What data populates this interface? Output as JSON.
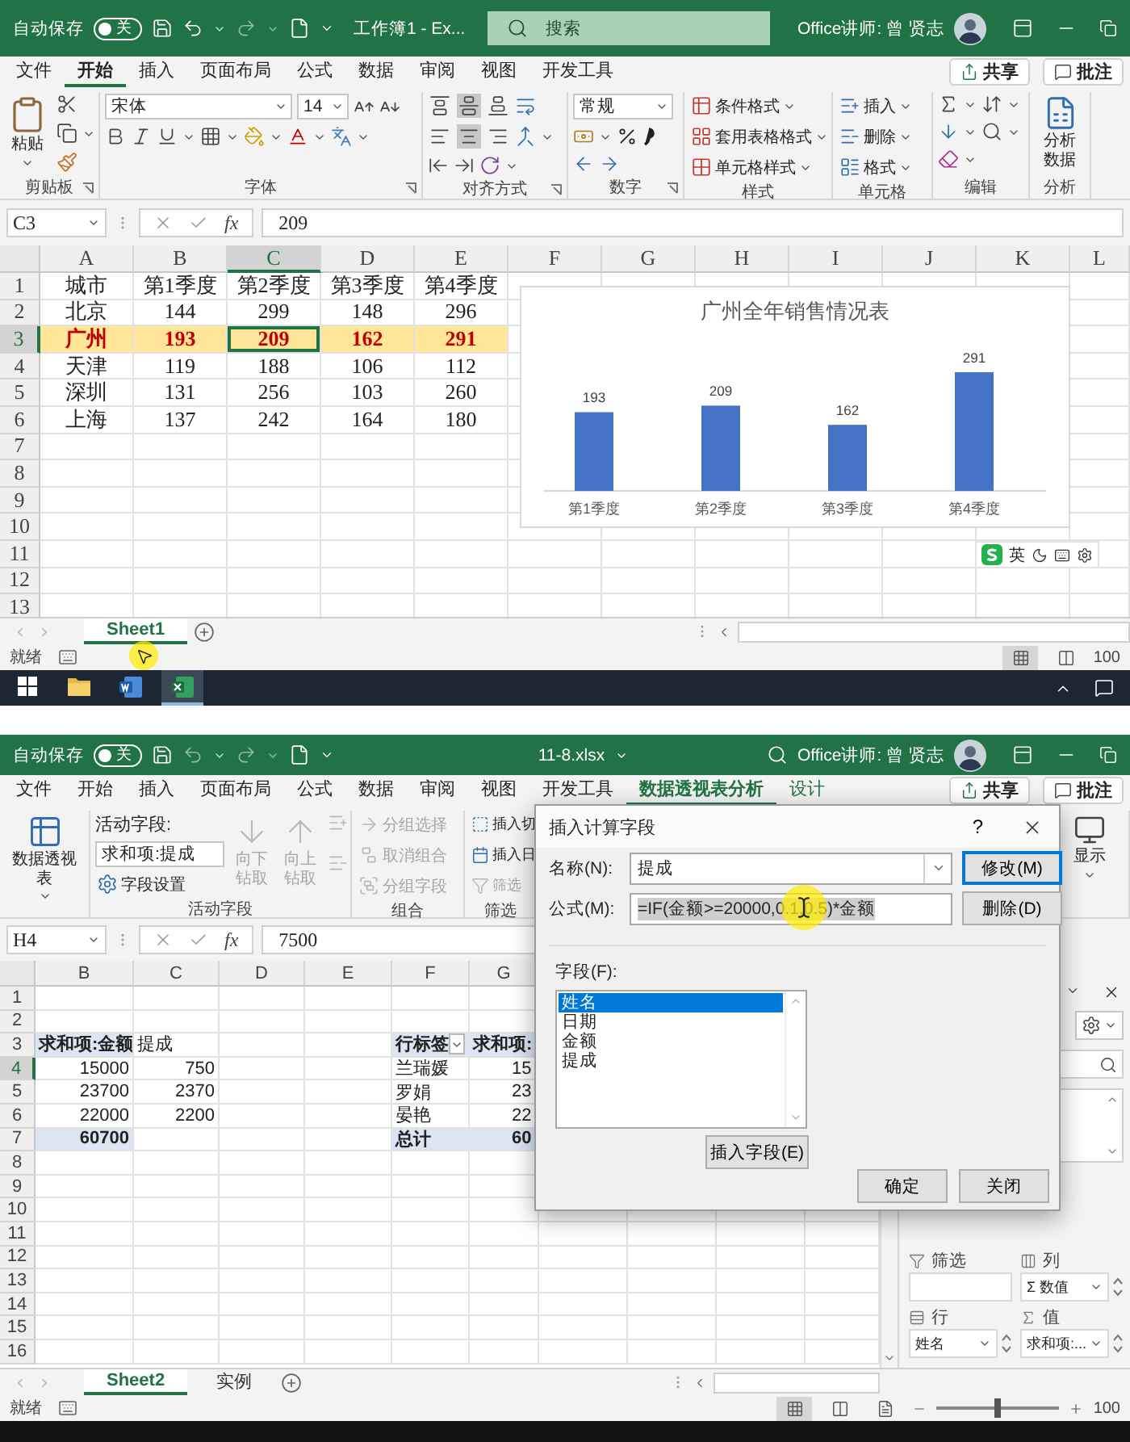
{
  "top_window": {
    "title_bar": {
      "autosave": "自动保存",
      "toggle": {
        "label": "关",
        "on": false
      },
      "document": "工作簿1 - Ex...",
      "search_placeholder": "搜索",
      "user": "Office讲师: 曾 贤志"
    },
    "tabs": [
      {
        "label": "文件",
        "selected": false
      },
      {
        "label": "开始",
        "selected": true
      },
      {
        "label": "插入",
        "selected": false
      },
      {
        "label": "页面布局",
        "selected": false
      },
      {
        "label": "公式",
        "selected": false
      },
      {
        "label": "数据",
        "selected": false
      },
      {
        "label": "审阅",
        "selected": false
      },
      {
        "label": "视图",
        "selected": false
      },
      {
        "label": "开发工具",
        "selected": false
      }
    ],
    "share_button": "共享",
    "comments_button": "批注",
    "ribbon": {
      "clipboard": {
        "paste": "粘贴",
        "label": "剪贴板"
      },
      "font": {
        "name": "宋体",
        "size": "14",
        "label": "字体"
      },
      "alignment": {
        "buttons": [
          {
            "selected": false
          },
          {
            "selected": true
          },
          {
            "selected": false
          },
          {
            "selected": false
          },
          {
            "selected": true
          },
          {
            "selected": false
          }
        ],
        "label": "对齐方式"
      },
      "number": {
        "format": "常规",
        "label": "数字"
      },
      "styles": {
        "items": [
          "条件格式",
          "套用表格格式",
          "单元格样式"
        ],
        "label": "样式"
      },
      "cells": {
        "items": [
          "插入",
          "删除",
          "格式"
        ],
        "label": "单元格"
      },
      "editing": {
        "label": "编辑"
      },
      "analysis": {
        "button": "分析数据",
        "label": "分析"
      }
    },
    "formula_bar": {
      "name_box": "C3",
      "fx": "fx",
      "value": "209"
    },
    "sheet": {
      "columns": [
        {
          "label": "A",
          "selected": false
        },
        {
          "label": "B",
          "selected": false
        },
        {
          "label": "C",
          "selected": true
        },
        {
          "label": "D",
          "selected": false
        },
        {
          "label": "E",
          "selected": false
        },
        {
          "label": "F",
          "selected": false
        },
        {
          "label": "G",
          "selected": false
        },
        {
          "label": "H",
          "selected": false
        },
        {
          "label": "I",
          "selected": false
        },
        {
          "label": "J",
          "selected": false
        },
        {
          "label": "K",
          "selected": false
        },
        {
          "label": "L",
          "selected": false
        }
      ],
      "rows": [
        {
          "header": "1",
          "selected": false,
          "highlighted": false,
          "cells": [
            {
              "text": "城市",
              "selected": false
            },
            {
              "text": "第1季度",
              "selected": false
            },
            {
              "text": "第2季度",
              "selected": false
            },
            {
              "text": "第3季度",
              "selected": false
            },
            {
              "text": "第4季度",
              "selected": false
            }
          ]
        },
        {
          "header": "2",
          "selected": false,
          "highlighted": false,
          "cells": [
            {
              "text": "北京",
              "selected": false
            },
            {
              "text": "144",
              "selected": false
            },
            {
              "text": "299",
              "selected": false
            },
            {
              "text": "148",
              "selected": false
            },
            {
              "text": "296",
              "selected": false
            }
          ]
        },
        {
          "header": "3",
          "selected": true,
          "highlighted": true,
          "cells": [
            {
              "text": "广州",
              "selected": false
            },
            {
              "text": "193",
              "selected": false
            },
            {
              "text": "209",
              "selected": true
            },
            {
              "text": "162",
              "selected": false
            },
            {
              "text": "291",
              "selected": false
            }
          ]
        },
        {
          "header": "4",
          "selected": false,
          "highlighted": false,
          "cells": [
            {
              "text": "天津",
              "selected": false
            },
            {
              "text": "119",
              "selected": false
            },
            {
              "text": "188",
              "selected": false
            },
            {
              "text": "106",
              "selected": false
            },
            {
              "text": "112",
              "selected": false
            }
          ]
        },
        {
          "header": "5",
          "selected": false,
          "highlighted": false,
          "cells": [
            {
              "text": "深圳",
              "selected": false
            },
            {
              "text": "131",
              "selected": false
            },
            {
              "text": "256",
              "selected": false
            },
            {
              "text": "103",
              "selected": false
            },
            {
              "text": "260",
              "selected": false
            }
          ]
        },
        {
          "header": "6",
          "selected": false,
          "highlighted": false,
          "cells": [
            {
              "text": "上海",
              "selected": false
            },
            {
              "text": "137",
              "selected": false
            },
            {
              "text": "242",
              "selected": false
            },
            {
              "text": "164",
              "selected": false
            },
            {
              "text": "180",
              "selected": false
            }
          ]
        },
        {
          "header": "7",
          "selected": false
        },
        {
          "header": "8",
          "selected": false
        },
        {
          "header": "9",
          "selected": false
        },
        {
          "header": "10",
          "selected": false
        },
        {
          "header": "11",
          "selected": false
        },
        {
          "header": "12",
          "selected": false
        },
        {
          "header": "13",
          "selected": false
        }
      ]
    },
    "chart_data": {
      "type": "bar",
      "title": "广州全年销售情况表",
      "categories": [
        "第1季度",
        "第2季度",
        "第3季度",
        "第4季度"
      ],
      "series": [
        {
          "color": "#4472c4",
          "values": [
            193,
            209,
            162,
            291
          ]
        }
      ],
      "data_labels": true
    },
    "ime": "英",
    "sheet_tabs": [
      {
        "label": "Sheet1",
        "selected": true
      }
    ],
    "status_bar": {
      "status": "就绪",
      "views": [
        {
          "selected": true
        },
        {
          "selected": false
        }
      ],
      "zoom": "100"
    },
    "taskbar": [
      {
        "kind": "start",
        "selected": false
      },
      {
        "kind": "folder",
        "selected": false
      },
      {
        "kind": "word",
        "selected": false
      },
      {
        "kind": "excel",
        "selected": true
      }
    ]
  },
  "bottom_window": {
    "title_bar": {
      "autosave": "自动保存",
      "toggle": {
        "label": "关",
        "on": false
      },
      "document": "11-8.xlsx",
      "user": "Office讲师: 曾 贤志"
    },
    "tabs": [
      {
        "label": "文件",
        "selected": false,
        "contextual": false
      },
      {
        "label": "开始",
        "selected": false,
        "contextual": false
      },
      {
        "label": "插入",
        "selected": false,
        "contextual": false
      },
      {
        "label": "页面布局",
        "selected": false,
        "contextual": false
      },
      {
        "label": "公式",
        "selected": false,
        "contextual": false
      },
      {
        "label": "数据",
        "selected": false,
        "contextual": false
      },
      {
        "label": "审阅",
        "selected": false,
        "contextual": false
      },
      {
        "label": "视图",
        "selected": false,
        "contextual": false
      },
      {
        "label": "开发工具",
        "selected": false,
        "contextual": false
      },
      {
        "label": "数据透视表分析",
        "selected": true,
        "contextual": true
      },
      {
        "label": "设计",
        "selected": false,
        "contextual": true
      }
    ],
    "share_button": "共享",
    "comments_button": "批注",
    "ribbon": {
      "pivot_table": "数据透视表",
      "active_field": {
        "caption": "活动字段:",
        "value": "求和项:提成",
        "settings": "字段设置",
        "drill_down": {
          "label": "向下钻取",
          "disabled": true
        },
        "drill_up": {
          "label": "向上钻取",
          "disabled": true
        },
        "label": "活动字段"
      },
      "group": {
        "items": [
          {
            "label": "分组选择",
            "disabled": true
          },
          {
            "label": "取消组合",
            "disabled": true
          },
          {
            "label": "分组字段",
            "disabled": true
          }
        ],
        "label": "组合"
      },
      "filter": {
        "items": [
          {
            "label": "插入切",
            "disabled": false
          },
          {
            "label": "插入日",
            "disabled": false
          },
          {
            "label": "筛选",
            "disabled": true
          }
        ],
        "label": "筛选"
      },
      "show": "显示"
    },
    "formula_bar": {
      "name_box": "H4",
      "fx": "fx",
      "value": "7500"
    },
    "sheet": {
      "columns": [
        {
          "label": "B",
          "selected": false
        },
        {
          "label": "C",
          "selected": false
        },
        {
          "label": "D",
          "selected": false
        },
        {
          "label": "E",
          "selected": false
        },
        {
          "label": "F",
          "selected": false
        },
        {
          "label": "G",
          "selected": false
        }
      ],
      "rows": [
        {
          "header": "1",
          "selected": false
        },
        {
          "header": "2",
          "selected": false
        },
        {
          "header": "3",
          "selected": false,
          "cells": [
            {
              "text": "求和项:金额",
              "kind": "header"
            },
            {
              "text": "提成",
              "kind": "label"
            },
            {
              "kind": "blank"
            },
            {
              "kind": "blank"
            },
            {
              "text": "行标签",
              "kind": "filter_header"
            },
            {
              "text": "求和项:",
              "kind": "header"
            }
          ]
        },
        {
          "header": "4",
          "selected": true,
          "cells": [
            {
              "text": "15000",
              "kind": "number"
            },
            {
              "text": "750",
              "kind": "number"
            },
            {
              "kind": "blank"
            },
            {
              "kind": "blank"
            },
            {
              "text": "兰瑞媛",
              "kind": "label"
            },
            {
              "text": "15",
              "kind": "partial"
            }
          ]
        },
        {
          "header": "5",
          "selected": false,
          "cells": [
            {
              "text": "23700",
              "kind": "number"
            },
            {
              "text": "2370",
              "kind": "number"
            },
            {
              "kind": "blank"
            },
            {
              "kind": "blank"
            },
            {
              "text": "罗娟",
              "kind": "label"
            },
            {
              "text": "23",
              "kind": "partial"
            }
          ]
        },
        {
          "header": "6",
          "selected": false,
          "cells": [
            {
              "text": "22000",
              "kind": "number"
            },
            {
              "text": "2200",
              "kind": "number"
            },
            {
              "kind": "blank"
            },
            {
              "kind": "blank"
            },
            {
              "text": "晏艳",
              "kind": "label"
            },
            {
              "text": "22",
              "kind": "partial"
            }
          ]
        },
        {
          "header": "7",
          "selected": false,
          "cells": [
            {
              "text": "60700",
              "kind": "total_number"
            },
            {
              "kind": "blank"
            },
            {
              "kind": "blank"
            },
            {
              "kind": "blank"
            },
            {
              "text": "总计",
              "kind": "total"
            },
            {
              "text": "60",
              "kind": "partial_total"
            }
          ]
        },
        {
          "header": "8",
          "selected": false
        },
        {
          "header": "9",
          "selected": false
        },
        {
          "header": "10",
          "selected": false
        },
        {
          "header": "11",
          "selected": false
        },
        {
          "header": "12",
          "selected": false
        },
        {
          "header": "13",
          "selected": false
        },
        {
          "header": "14",
          "selected": false
        },
        {
          "header": "15",
          "selected": false
        },
        {
          "header": "16",
          "selected": false
        }
      ]
    },
    "dialog": {
      "title": "插入计算字段",
      "help": "?",
      "name_label": "名称(N):",
      "name_value": "提成",
      "formula_label": "公式(M):",
      "formula_value": "=IF(金额>=20000,0.1,0.5)*金额",
      "formula_selected": true,
      "modify": "修改(M)",
      "delete": "删除(D)",
      "fields_label": "字段(F):",
      "fields": [
        {
          "label": "姓名",
          "selected": true
        },
        {
          "label": "日期",
          "selected": false
        },
        {
          "label": "金额",
          "selected": false
        },
        {
          "label": "提成",
          "selected": false
        }
      ],
      "insert_field": "插入字段(E)",
      "ok": "确定",
      "close": "关闭"
    },
    "field_list": {
      "areas": [
        {
          "kind": "filter",
          "label": "筛选"
        },
        {
          "kind": "columns",
          "label": "列",
          "item": "Σ 数值"
        },
        {
          "kind": "rows",
          "label": "行",
          "item": "姓名"
        },
        {
          "kind": "values",
          "label": "值",
          "item": "求和项:..."
        }
      ]
    },
    "sheet_tabs": [
      {
        "label": "Sheet2",
        "selected": true
      },
      {
        "label": "实例",
        "selected": false
      }
    ],
    "status_bar": {
      "status": "就绪",
      "views": [
        {
          "selected": true
        },
        {
          "selected": false
        },
        {
          "selected": false
        }
      ],
      "zoom_slider": {
        "level": 0.5
      },
      "zoom": "100"
    }
  }
}
